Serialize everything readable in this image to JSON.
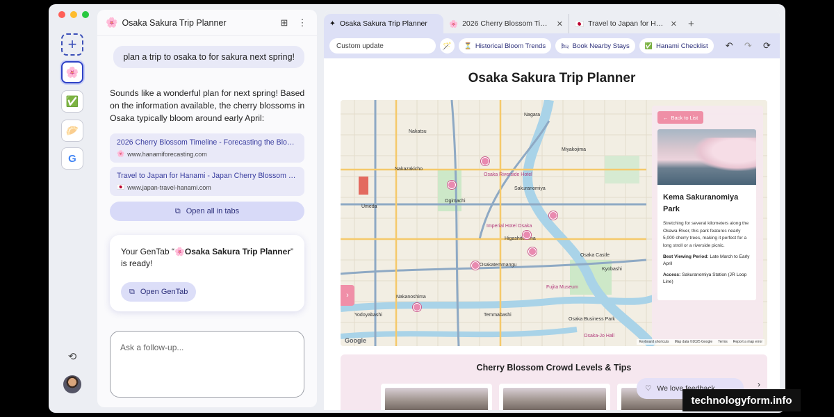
{
  "sidebar": {
    "new_label": "+",
    "items": [
      {
        "icon": "sakura-icon",
        "glyph": "🌸"
      },
      {
        "icon": "checkbox-icon",
        "glyph": "✅"
      },
      {
        "icon": "bowl-icon",
        "glyph": "🥟"
      },
      {
        "icon": "google-icon",
        "glyph": "G"
      }
    ],
    "history_glyph": "⟲"
  },
  "chat": {
    "header_title": "Osaka Sakura Trip Planner",
    "header_logo": "🌸",
    "user_message": "plan a trip to osaka to for sakura next spring!",
    "reply": "Sounds like a wonderful plan for next spring! Based on the information available, the cherry blossoms in Osaka typically bloom around early April:",
    "sources": [
      {
        "title": "2026 Cherry Blossom Timeline - Forecasting the Bloom...",
        "url": "www.hanamiforecasting.com",
        "favicon": "🌸"
      },
      {
        "title": "Travel to Japan for Hanami - Japan Cherry Blossom 20...",
        "url": "www.japan-travel-hanami.com",
        "favicon": "🇯🇵"
      }
    ],
    "open_all_label": "Open all in tabs",
    "ready_prefix": "Your GenTab “",
    "ready_name": "🌸Osaka Sakura Trip Planner",
    "ready_suffix": "” is ready!",
    "open_gentab_label": "Open GenTab",
    "followup_placeholder": "Ask a follow-up..."
  },
  "browser": {
    "tabs": [
      {
        "label": "Osaka Sakura Trip Planner",
        "icon": "✦"
      },
      {
        "label": "2026 Cherry Blossom Timeline",
        "icon": "🌸"
      },
      {
        "label": "Travel to Japan for Hanami - J",
        "icon": "🇯🇵"
      }
    ],
    "toolbar": {
      "custom_placeholder": "Custom update",
      "chips": [
        {
          "label": "Historical Bloom Trends",
          "icon": "⏳"
        },
        {
          "label": "Book Nearby Stays",
          "icon": "🛏"
        },
        {
          "label": "Hanami Checklist",
          "icon": "✅"
        }
      ]
    },
    "page": {
      "title": "Osaka Sakura Trip Planner",
      "back_label": "Back to List",
      "place_name": "Kema Sakuranomiya Park",
      "place_desc": "Stretching for several kilometers along the Okawa River, this park features nearly 5,000 cherry trees, making it perfect for a long stroll or a riverside picnic.",
      "best_label": "Best Viewing Period:",
      "best_value": "Late March to Early April",
      "access_label": "Access:",
      "access_value": "Sakuranomiya Station (JR Loop Line)",
      "map_attrib": [
        "Keyboard shortcuts",
        "Map data ©2025 Google",
        "Terms",
        "Report a map error"
      ],
      "google_label": "Google",
      "map_labels": [
        {
          "text": "Nagara",
          "poi": false
        },
        {
          "text": "Nakatsu",
          "poi": false
        },
        {
          "text": "Miyakojima",
          "poi": false
        },
        {
          "text": "Nakazakicho",
          "poi": false
        },
        {
          "text": "Osaka Riverside Hotel",
          "poi": true
        },
        {
          "text": "Umeda",
          "poi": false
        },
        {
          "text": "Ogimachi",
          "poi": false
        },
        {
          "text": "Sakuranomiya",
          "poi": false
        },
        {
          "text": "Imperial Hotel Osaka",
          "poi": true
        },
        {
          "text": "Higashitemma",
          "poi": false
        },
        {
          "text": "Osaka Castle",
          "poi": false
        },
        {
          "text": "Kyobashi",
          "poi": false
        },
        {
          "text": "Fujita Museum",
          "poi": true
        },
        {
          "text": "Osakatemmangu",
          "poi": false
        },
        {
          "text": "Temmabashi",
          "poi": false
        },
        {
          "text": "Osaka Business Park",
          "poi": false
        },
        {
          "text": "Yodoyabashi",
          "poi": false
        },
        {
          "text": "Osaka-Jo Hall",
          "poi": true
        },
        {
          "text": "Nakanoshima",
          "poi": false
        }
      ]
    },
    "crowd_title": "Cherry Blossom Crowd Levels & Tips",
    "feedback_label": "We love feedback"
  },
  "watermark": "technologyform.info"
}
